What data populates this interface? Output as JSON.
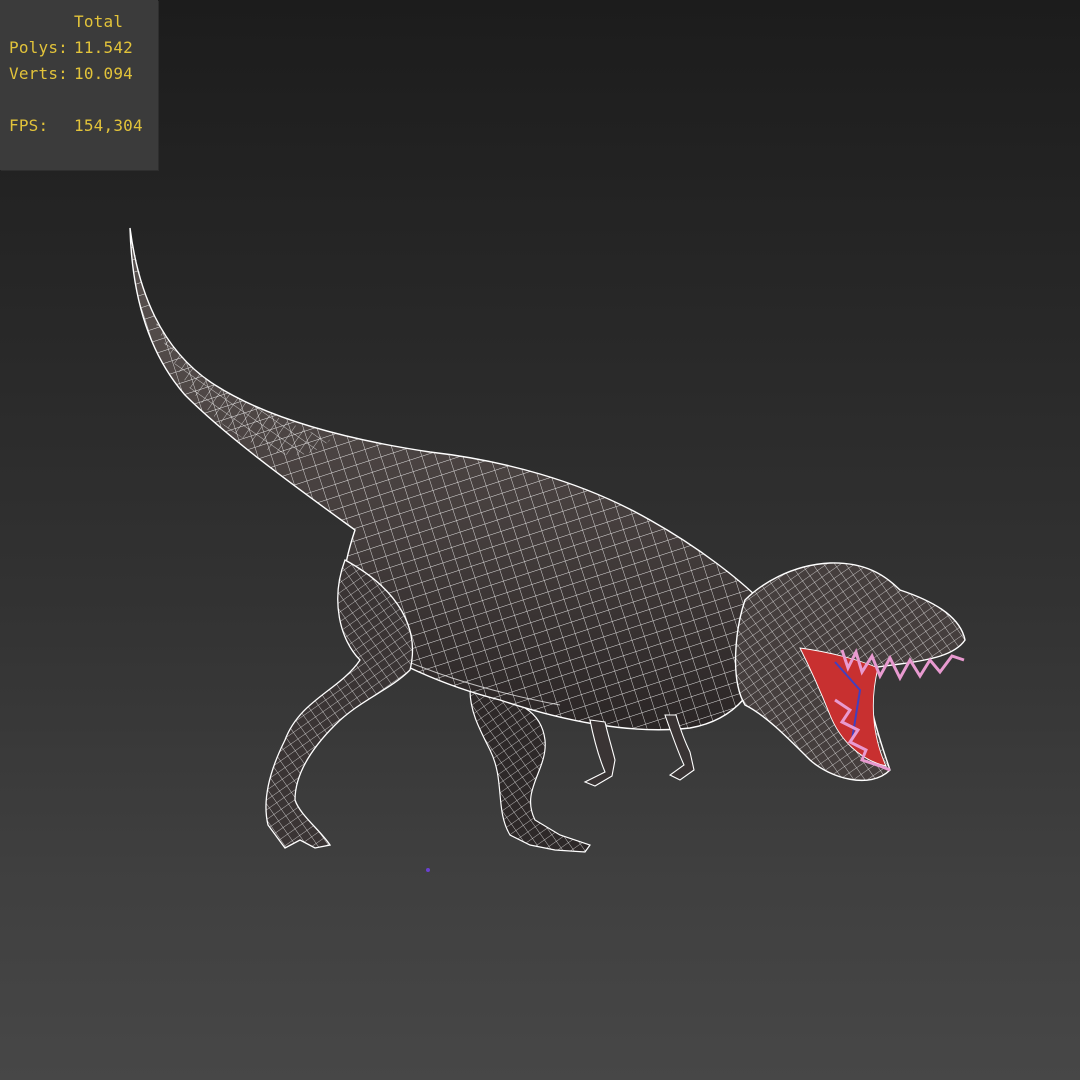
{
  "viewport": {
    "name": "3d-viewport",
    "background_top": "#1c1c1c",
    "background_bottom": "#474747"
  },
  "stats": {
    "header": "Total",
    "polys_label": "Polys:",
    "polys_value": "11.542",
    "verts_label": "Verts:",
    "verts_value": "10.094",
    "fps_label": "FPS:",
    "fps_value": "154,304",
    "text_color": "#e2c33a"
  },
  "model": {
    "subject": "tyrannosaurus-rex",
    "display_mode": "textured-with-wireframe",
    "wire_color": "#ffffff",
    "skin_color": "#4a4444",
    "mouth_color": "#c83030",
    "teeth_color": "#e89ad0"
  }
}
